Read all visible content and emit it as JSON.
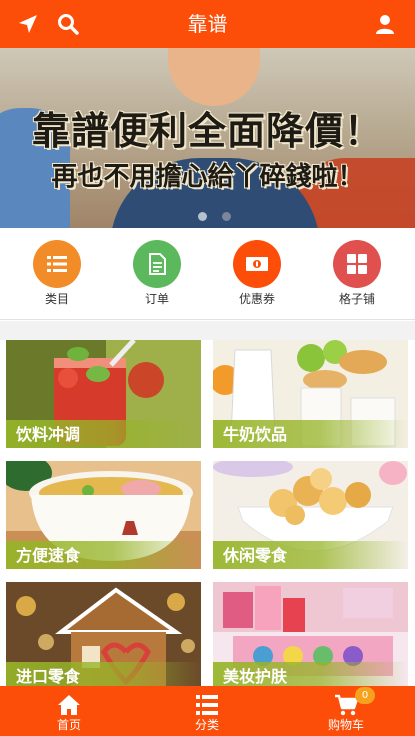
{
  "header": {
    "title": "靠谱",
    "left_icons": [
      "location-arrow-icon",
      "search-icon"
    ],
    "right_icon": "user-icon",
    "color": "#fc4e09"
  },
  "banner": {
    "line1": "靠譜便利全面降價！",
    "line2": "再也不用擔心給丫碎錢啦！",
    "slide_count": 2,
    "active_slide": 2
  },
  "quick_nav": [
    {
      "label": "类目",
      "icon": "list-icon",
      "color": "#f28c28"
    },
    {
      "label": "订单",
      "icon": "document-icon",
      "color": "#5cb85c"
    },
    {
      "label": "优惠券",
      "icon": "money-icon",
      "color": "#fc4e09"
    },
    {
      "label": "格子铺",
      "icon": "grid-icon",
      "color": "#e0504f"
    }
  ],
  "categories": [
    {
      "label": "饮料冲调",
      "image": "strawberry-drink"
    },
    {
      "label": "牛奶饮品",
      "image": "milk-and-pastries"
    },
    {
      "label": "方便速食",
      "image": "noodle-bowl"
    },
    {
      "label": "休闲零食",
      "image": "popcorn-bowl"
    },
    {
      "label": "进口零食",
      "image": "gingerbread-house"
    },
    {
      "label": "美妆护肤",
      "image": "cosmetics-box"
    }
  ],
  "tabbar": [
    {
      "label": "首页",
      "icon": "home-icon"
    },
    {
      "label": "分类",
      "icon": "list-icon"
    },
    {
      "label": "购物车",
      "icon": "cart-icon"
    }
  ],
  "cart_badge": "0"
}
